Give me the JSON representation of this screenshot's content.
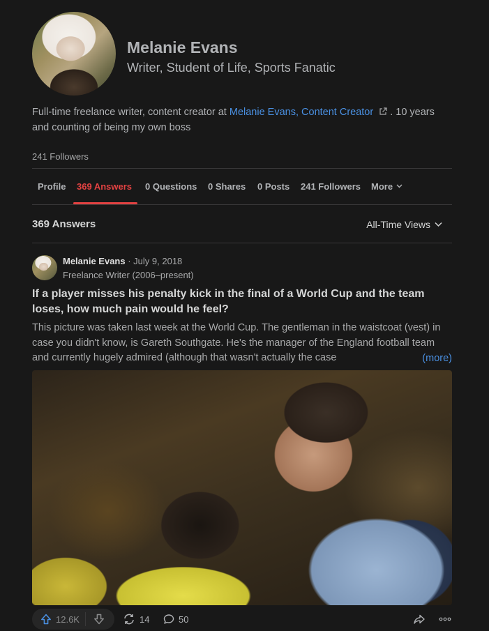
{
  "profile": {
    "name": "Melanie Evans",
    "tagline": "Writer, Student of Life, Sports Fanatic",
    "bio_before_link": "Full-time freelance writer, content creator at ",
    "bio_link": "Melanie Evans, Content Creator",
    "bio_after_link": ". 10 years and counting of being my own boss",
    "followers": "241 Followers"
  },
  "tabs": [
    {
      "label": "Profile"
    },
    {
      "label": "369 Answers"
    },
    {
      "label": "0 Questions"
    },
    {
      "label": "0 Shares"
    },
    {
      "label": "0 Posts"
    },
    {
      "label": "241 Followers"
    },
    {
      "label": "More"
    }
  ],
  "active_tab": "369 Answers",
  "answers_header": {
    "count": "369 Answers",
    "sort": "All-Time Views"
  },
  "answer": {
    "author": "Melanie Evans",
    "date": "· July 9, 2018",
    "credential": "Freelance Writer (2006–present)",
    "question": "If a player misses his penalty kick in the final of a World Cup and the team loses, how much pain would he feel?",
    "excerpt": "This picture was taken last week at the World Cup. The gentleman in the waistcoat (vest) in case you didn't know, is Gareth Southgate. He's the manager of the England football team and currently hugely admired (although that wasn't actually the case",
    "more": "(more)",
    "upvotes": "12.6K",
    "shares": "14",
    "comments": "50"
  },
  "icons": {
    "external": "external-link-icon",
    "chevron": "chevron-down-icon",
    "upvote": "upvote-icon",
    "downvote": "downvote-icon",
    "reshare": "reshare-icon",
    "comment": "comment-icon",
    "share": "share-icon",
    "more": "more-dots-icon"
  },
  "colors": {
    "background": "#181818",
    "accent": "#e34242",
    "link": "#4a90e2",
    "text": "#d5d6d6",
    "muted": "#a8a9aa"
  }
}
